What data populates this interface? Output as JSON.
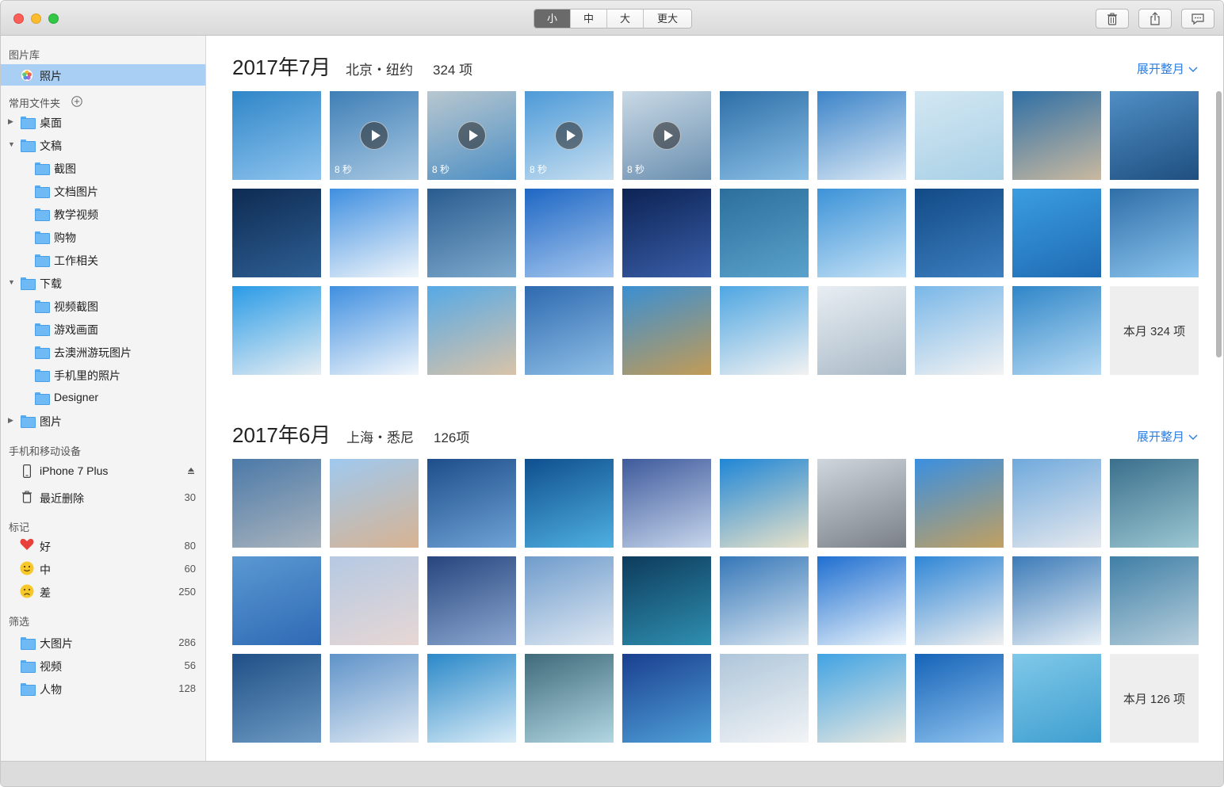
{
  "toolbar": {
    "size_segments": [
      "小",
      "中",
      "大",
      "更大"
    ],
    "active_segment": "小",
    "icons": [
      "trash-icon",
      "share-icon",
      "feedback-icon"
    ]
  },
  "sidebar": {
    "library_label": "图片库",
    "photos_item": "照片",
    "favorites_label": "常用文件夹",
    "folders": [
      {
        "label": "桌面",
        "level": 0,
        "disclosure": "▶"
      },
      {
        "label": "文稿",
        "level": 0,
        "disclosure": "▼"
      },
      {
        "label": "截图",
        "level": 1,
        "disclosure": ""
      },
      {
        "label": "文档图片",
        "level": 1,
        "disclosure": ""
      },
      {
        "label": "教学视频",
        "level": 1,
        "disclosure": ""
      },
      {
        "label": "购物",
        "level": 1,
        "disclosure": ""
      },
      {
        "label": "工作相关",
        "level": 1,
        "disclosure": ""
      },
      {
        "label": "下载",
        "level": 0,
        "disclosure": "▼"
      },
      {
        "label": "视频截图",
        "level": 1,
        "disclosure": ""
      },
      {
        "label": "游戏画面",
        "level": 1,
        "disclosure": ""
      },
      {
        "label": "去澳洲游玩图片",
        "level": 1,
        "disclosure": ""
      },
      {
        "label": "手机里的照片",
        "level": 1,
        "disclosure": ""
      },
      {
        "label": "Designer",
        "level": 1,
        "disclosure": ""
      },
      {
        "label": "图片",
        "level": 0,
        "disclosure": "▶"
      }
    ],
    "devices_label": "手机和移动设备",
    "device_name": "iPhone 7 Plus",
    "recently_deleted": "最近删除",
    "recently_deleted_count": "30",
    "tags_label": "标记",
    "tags": [
      {
        "label": "好",
        "count": "80",
        "icon": "heart-icon"
      },
      {
        "label": "中",
        "count": "60",
        "icon": "smile-icon"
      },
      {
        "label": "差",
        "count": "250",
        "icon": "frown-icon"
      }
    ],
    "filter_label": "筛选",
    "filters": [
      {
        "label": "大图片",
        "count": "286"
      },
      {
        "label": "视频",
        "count": "56"
      },
      {
        "label": "人物",
        "count": "128"
      }
    ]
  },
  "groups": [
    {
      "title": "2017年7月",
      "location": "北京・纽约",
      "count": "324 项",
      "expand": "展开整月",
      "more_label": "本月 324 项",
      "video_duration": "8 秒",
      "photos": [
        [
          "#2f86c8",
          "#8fc4ee"
        ],
        [
          "#3f7fb6",
          "#a9c9e3"
        ],
        [
          "#b8c7cf",
          "#4d8fc4"
        ],
        [
          "#4d9ad8",
          "#c7dff0"
        ],
        [
          "#c9d9e5",
          "#6a8fb0"
        ],
        [
          "#2d6fa8",
          "#8cc0e6"
        ],
        [
          "#3c84c9",
          "#dbe9f5"
        ],
        [
          "#d3e7f2",
          "#a8d0e6"
        ],
        [
          "#2f6fa5",
          "#c9b9a0"
        ],
        [
          "#4f8ec4",
          "#1f4f80"
        ],
        [
          "#0e2b52",
          "#2e5f94"
        ],
        [
          "#3f8fe0",
          "#f1f6fb"
        ],
        [
          "#2a5c90",
          "#7eaacd"
        ],
        [
          "#1e67c4",
          "#a7c8ef"
        ],
        [
          "#0c2354",
          "#3a5ea8"
        ],
        [
          "#2c6f9c",
          "#5aa2cc"
        ],
        [
          "#3c93d8",
          "#c6e2f6"
        ],
        [
          "#124a86",
          "#3d7fc0"
        ],
        [
          "#3b9de0",
          "#1f6bb3"
        ],
        [
          "#2f6ea8",
          "#8cc5ee"
        ],
        [
          "#2a9be6",
          "#e7eef3"
        ],
        [
          "#3f8fe0",
          "#f1f6fb"
        ],
        [
          "#56a9e6",
          "#d9c3a8"
        ],
        [
          "#2e6ab0",
          "#8fbfe6"
        ],
        [
          "#3a8fd3",
          "#c29b56"
        ],
        [
          "#4ea6e2",
          "#f2f2f2"
        ],
        [
          "#e8eef3",
          "#a9b9c6"
        ],
        [
          "#79b7e8",
          "#f3f3f3"
        ],
        [
          "#2f86c8",
          "#b8dbf4"
        ]
      ]
    },
    {
      "title": "2017年6月",
      "location": "上海・悉尼",
      "count": "126项",
      "expand": "展开整月",
      "more_label": "本月 126 项",
      "video_duration": "",
      "photos": [
        [
          "#4b79a8",
          "#aab4bd"
        ],
        [
          "#9fc9ef",
          "#d8b392"
        ],
        [
          "#1e4e8a",
          "#6fa3d6"
        ],
        [
          "#0f4f8f",
          "#4fb0e0"
        ],
        [
          "#3e5a9c",
          "#c7d6ec"
        ],
        [
          "#1f86d6",
          "#e8e2c9"
        ],
        [
          "#cfd6dd",
          "#7a7f88"
        ],
        [
          "#3a8fe0",
          "#c2a060"
        ],
        [
          "#6fa9dc",
          "#e6e9ee"
        ],
        [
          "#3a6f8c",
          "#9cc7d2"
        ],
        [
          "#5a98d2",
          "#2f6ab4"
        ],
        [
          "#b5c9e3",
          "#e7d7d4"
        ],
        [
          "#27457e",
          "#8ca8d1"
        ],
        [
          "#6f9ccc",
          "#dfe8f2"
        ],
        [
          "#0d3b5c",
          "#2f8fb0"
        ],
        [
          "#3577b8",
          "#d9e6f1"
        ],
        [
          "#1f6fd0",
          "#e9f3fb"
        ],
        [
          "#2f86d6",
          "#f0f0f0"
        ],
        [
          "#3c7bb8",
          "#eaf1f7"
        ],
        [
          "#3f7fa6",
          "#b7cfdc"
        ],
        [
          "#1f4f86",
          "#6e9bc4"
        ],
        [
          "#5f93c9",
          "#dfe9f3"
        ],
        [
          "#2a88c8",
          "#d9ecf7"
        ],
        [
          "#3f6a7a",
          "#b2d7e3"
        ],
        [
          "#1a3f8f",
          "#4fa0d8"
        ],
        [
          "#aec6da",
          "#f2f4f6"
        ],
        [
          "#41a3e3",
          "#e8e8e0"
        ],
        [
          "#1563b8",
          "#8fc3ee"
        ],
        [
          "#7fc8e8",
          "#3f9fd0"
        ]
      ]
    }
  ]
}
